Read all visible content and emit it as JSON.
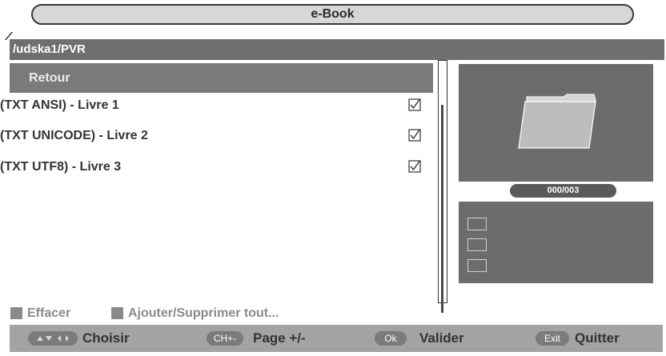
{
  "header": {
    "title": "e-Book"
  },
  "path": "/udska1/PVR",
  "list": {
    "back_label": "Retour",
    "files": [
      {
        "label": "(TXT ANSI) - Livre 1",
        "checked": true
      },
      {
        "label": "(TXT UNICODE) - Livre 2",
        "checked": true
      },
      {
        "label": "(TXT UTF8) - Livre 3",
        "checked": true
      }
    ]
  },
  "preview": {
    "icon": "folder-icon",
    "counter": "000/003"
  },
  "legend": {
    "delete_label": "Effacer",
    "toggle_all_label": "Ajouter/Supprimer tout..."
  },
  "footer": {
    "nav_icon": "arrows-icon",
    "choose_label": "Choisir",
    "ch_key": "CH+-",
    "page_label": "Page +/-",
    "ok_key": "Ok",
    "validate_label": "Valider",
    "exit_key": "Exit",
    "quit_label": "Quitter"
  },
  "colors": {
    "bar_dark": "#6f6f6f",
    "selection": "#7a7a7a",
    "footer_bg": "#a3a3a3",
    "panel_bg": "#6c6c6c"
  }
}
